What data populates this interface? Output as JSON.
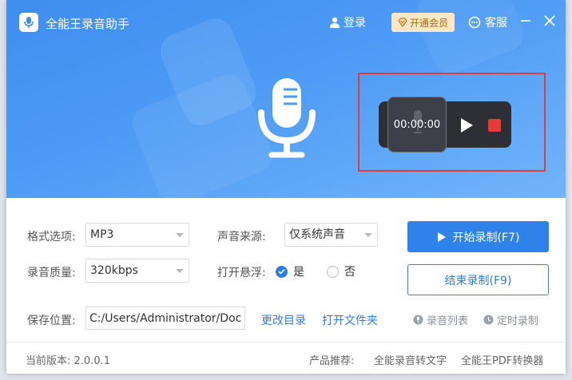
{
  "app": {
    "title": "全能王录音助手"
  },
  "header": {
    "login": "登录",
    "vip": "开通会员",
    "service": "客服"
  },
  "widget": {
    "timer": "00:00:00"
  },
  "form": {
    "format_label": "格式选项:",
    "format_value": "MP3",
    "source_label": "声音来源:",
    "source_value": "仅系统声音",
    "quality_label": "录音质量:",
    "quality_value": "320kbps",
    "float_label": "打开悬浮:",
    "float_yes": "是",
    "float_no": "否",
    "save_label": "保存位置:",
    "save_path": "C:/Users/Administrator/Documents",
    "change_dir": "更改目录",
    "open_folder": "打开文件夹"
  },
  "actions": {
    "start": "开始录制(F7)",
    "stop": "结束录制(F9)",
    "list": "录音列表",
    "timer": "定时录制"
  },
  "footer": {
    "version": "当前版本: 2.0.0.1",
    "rec_label": "产品推荐:",
    "rec_1": "全能录音转文字",
    "rec_2": "全能王PDF转换器"
  },
  "colors": {
    "primary": "#2f82e9",
    "header": "#4d9bf5",
    "stop": "#e83a3a",
    "highlight": "#e03c3c"
  },
  "icons": [
    "mic-icon",
    "user-icon",
    "vip-icon",
    "headset-icon",
    "minimize-icon",
    "close-icon",
    "play-icon",
    "stop-icon",
    "check-icon",
    "list-icon",
    "clock-icon"
  ]
}
